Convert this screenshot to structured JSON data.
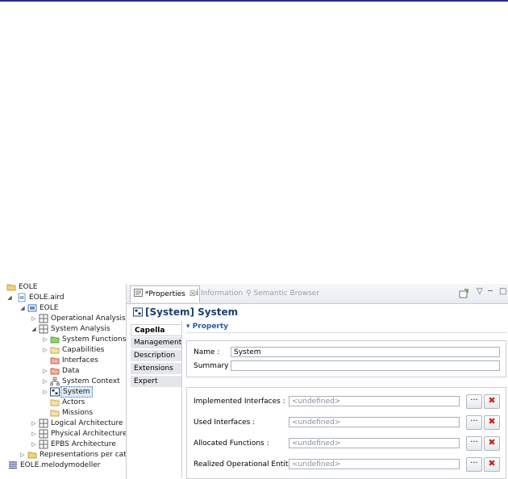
{
  "tree": {
    "items": [
      {
        "label": "EOLE",
        "icon": "folder-icon"
      },
      {
        "label": "EOLE.aird",
        "icon": "aird-file-icon"
      },
      {
        "label": "EOLE",
        "icon": "project-icon"
      },
      {
        "label": "Operational Analysis",
        "icon": "grid-icon"
      },
      {
        "label": "System Analysis",
        "icon": "grid-icon"
      },
      {
        "label": "System Functions",
        "icon": "folder-green-icon"
      },
      {
        "label": "Capabilities",
        "icon": "folder-open-icon"
      },
      {
        "label": "Interfaces",
        "icon": "folder-red-icon"
      },
      {
        "label": "Data",
        "icon": "folder-red-icon"
      },
      {
        "label": "System Context",
        "icon": "context-icon"
      },
      {
        "label": "System",
        "icon": "system-icon"
      },
      {
        "label": "Actors",
        "icon": "folder-open-icon"
      },
      {
        "label": "Missions",
        "icon": "folder-open-icon"
      },
      {
        "label": "Logical Architecture",
        "icon": "grid-icon"
      },
      {
        "label": "Physical Architecture",
        "icon": "grid-icon"
      },
      {
        "label": "EPBS Architecture",
        "icon": "grid-icon"
      },
      {
        "label": "Representations per catego",
        "icon": "folder-icon"
      },
      {
        "label": "EOLE.melodymodeller",
        "icon": "model-file-icon"
      }
    ]
  },
  "view": {
    "tabs": {
      "properties": "*Properties",
      "properties_close": "☒",
      "information": "Information",
      "semantic_browser": "Semantic Browser"
    },
    "title": "[System] System",
    "side_tabs": [
      "Capella",
      "Management",
      "Description",
      "Extensions",
      "Expert"
    ],
    "section": "Property",
    "name_label": "Name :",
    "name_value": "System",
    "summary_label": "Summary :",
    "summary_value": "",
    "fields": [
      {
        "label": "Implemented Interfaces :",
        "value": "<undefined>"
      },
      {
        "label": "Used Interfaces :",
        "value": "<undefined>"
      },
      {
        "label": "Allocated Functions :",
        "value": "<undefined>"
      },
      {
        "label": "Realized Operational Entities :",
        "value": "<undefined>"
      }
    ],
    "browse_label": "···",
    "delete_label": "✖",
    "toolbar_menu": "▽",
    "toolbar_min": "─",
    "toolbar_max": "□"
  },
  "colors": {
    "title": "#1f3f70",
    "section": "#2b5aa8",
    "accent_bar": "#2b2e8c",
    "delete": "#d02020"
  }
}
